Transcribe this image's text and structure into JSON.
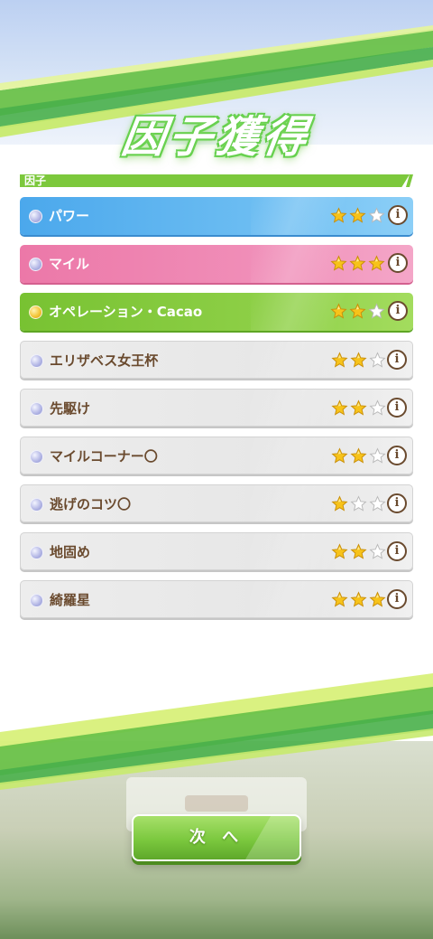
{
  "screen": {
    "title": "因子獲得",
    "section_label": "因子",
    "next_button_label": "次 へ",
    "background_blur_text": "閉じる"
  },
  "factors": [
    {
      "name": "パワー",
      "stars": 2,
      "max_stars": 3,
      "style": "blue",
      "dot": "silver"
    },
    {
      "name": "マイル",
      "stars": 3,
      "max_stars": 3,
      "style": "pink",
      "dot": "silver"
    },
    {
      "name": "オペレーション・Cacao",
      "stars": 2,
      "max_stars": 3,
      "style": "green",
      "dot": "gold"
    },
    {
      "name": "エリザベス女王杯",
      "stars": 2,
      "max_stars": 3,
      "style": "gray",
      "dot": "silver"
    },
    {
      "name": "先駆け",
      "stars": 2,
      "max_stars": 3,
      "style": "gray",
      "dot": "silver"
    },
    {
      "name": "マイルコーナー〇",
      "stars": 2,
      "max_stars": 3,
      "style": "gray",
      "dot": "silver"
    },
    {
      "name": "逃げのコツ〇",
      "stars": 1,
      "max_stars": 3,
      "style": "gray",
      "dot": "silver"
    },
    {
      "name": "地固め",
      "stars": 2,
      "max_stars": 3,
      "style": "gray",
      "dot": "silver"
    },
    {
      "name": "綺羅星",
      "stars": 3,
      "max_stars": 3,
      "style": "gray",
      "dot": "silver"
    }
  ],
  "icons": {
    "info": "info-icon",
    "star_filled": "star-filled-icon",
    "star_empty": "star-empty-icon"
  },
  "colors": {
    "blue": "#4ba8ec",
    "pink": "#ec78a8",
    "green": "#78c232",
    "gray": "#e8e8e8",
    "text_brown": "#6a4a2e",
    "star_gold": "#f5c518"
  }
}
